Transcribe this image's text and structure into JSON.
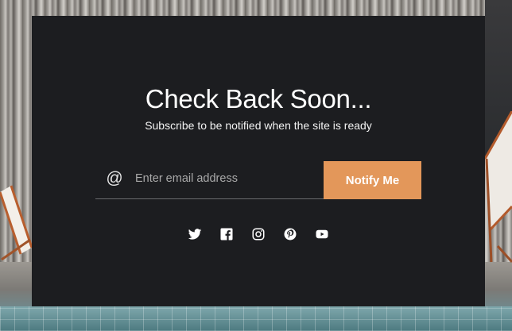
{
  "card": {
    "title": "Check Back Soon...",
    "subtitle": "Subscribe to be notified when the site is ready"
  },
  "form": {
    "at_symbol": "@",
    "email_placeholder": "Enter email address",
    "email_value": "",
    "notify_label": "Notify Me"
  },
  "social": [
    "twitter-icon",
    "facebook-icon",
    "instagram-icon",
    "pinterest-icon",
    "youtube-icon"
  ],
  "colors": {
    "card_bg": "#1c1d20",
    "button_bg": "#e3975a",
    "text": "#ffffff"
  }
}
